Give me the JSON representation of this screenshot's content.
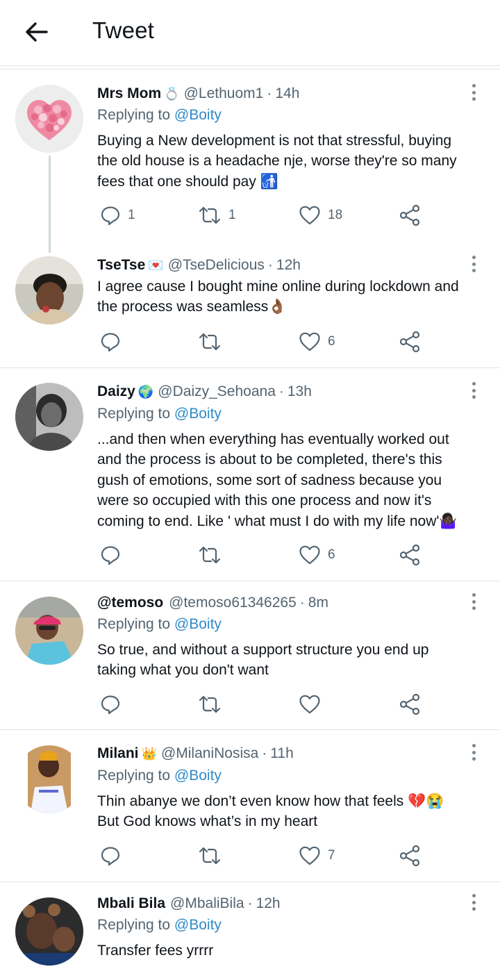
{
  "header": {
    "title": "Tweet"
  },
  "tweets": [
    {
      "name": "Mrs Mom",
      "badge": "💍",
      "handle": "@Lethuom1",
      "time": "14h",
      "replying_prefix": "Replying to",
      "replying_to": "@Boity",
      "text": "Buying a New development is not that stressful, buying\nthe old house is a headache nje, worse they're so many\nfees that one should pay 🚮",
      "replies": "1",
      "retweets": "1",
      "likes": "18"
    },
    {
      "name": "TseTse",
      "badge": "💌",
      "handle": "@TseDelicious",
      "time": "12h",
      "text": "I agree cause I bought mine online during lockdown and\nthe process was seamless👌🏾",
      "replies": "",
      "retweets": "",
      "likes": "6"
    },
    {
      "name": "Daizy",
      "badge": "🌍",
      "handle": "@Daizy_Sehoana",
      "time": "13h",
      "replying_prefix": "Replying to",
      "replying_to": "@Boity",
      "text": "...and then when everything has eventually worked out\nand the process is about to be completed, there's this\ngush of emotions, some sort of sadness because you\nwere so occupied with this one process and now it's\ncoming to end. Like ' what must I do with my life now'🤷🏿‍♀️",
      "replies": "",
      "retweets": "",
      "likes": "6"
    },
    {
      "name": "@temoso",
      "badge": "",
      "handle": "@temoso61346265",
      "time": "8m",
      "replying_prefix": "Replying to",
      "replying_to": "@Boity",
      "text": "So true,  and without a support structure you end up\ntaking what you don't want",
      "replies": "",
      "retweets": "",
      "likes": ""
    },
    {
      "name": "Milani",
      "badge": "👑",
      "handle": "@MilaniNosisa",
      "time": "11h",
      "replying_prefix": "Replying to",
      "replying_to": "@Boity",
      "text": "Thin abanye we don’t even know how that feels 💔😭\nBut God knows what’s in my heart",
      "replies": "",
      "retweets": "",
      "likes": "7"
    },
    {
      "name": "Mbali Bila",
      "badge": "",
      "handle": "@MbaliBila",
      "time": "12h",
      "replying_prefix": "Replying to",
      "replying_to": "@Boity",
      "text": "Transfer fees yrrrr"
    }
  ],
  "colors": {
    "text": "#0f1419",
    "muted": "#536471",
    "link": "#2e8bc9",
    "icon": "#536471",
    "divider": "#e3e3e3"
  },
  "icons": {
    "back": "arrow-left-icon",
    "more": "more-vertical-icon",
    "reply": "reply-icon",
    "retweet": "retweet-icon",
    "like": "heart-icon",
    "share": "share-icon"
  }
}
